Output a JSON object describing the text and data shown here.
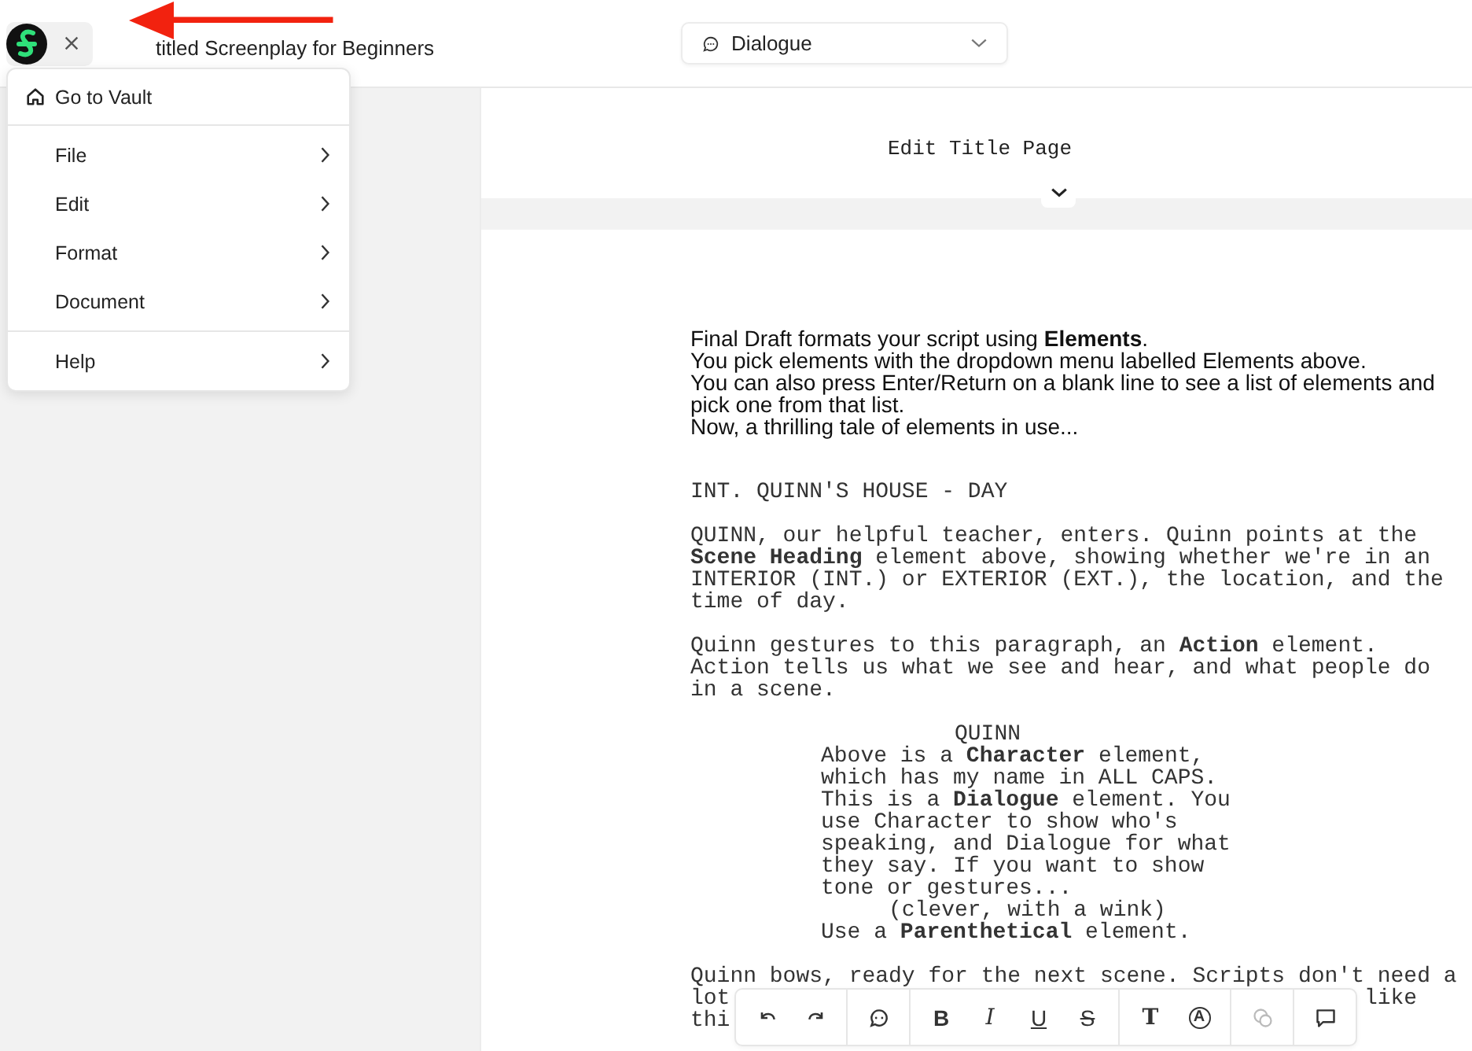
{
  "header": {
    "title": "titled Screenplay for Beginners",
    "element_dropdown": {
      "value": "Dialogue"
    }
  },
  "menu": {
    "sections": [
      [
        {
          "label": "Go to Vault",
          "kind": "home"
        }
      ],
      [
        {
          "label": "File",
          "kind": "submenu"
        },
        {
          "label": "Edit",
          "kind": "submenu"
        },
        {
          "label": "Format",
          "kind": "submenu"
        },
        {
          "label": "Document",
          "kind": "submenu"
        }
      ],
      [
        {
          "label": "Help",
          "kind": "submenu"
        }
      ]
    ]
  },
  "title_page": {
    "label": "Edit Title Page"
  },
  "script": {
    "intro": [
      "Final Draft formats your script using **Elements**.",
      "You pick elements with the dropdown menu labelled Elements above.",
      "You can also press Enter/Return on a blank line to see a list of elements and",
      "pick one from that list.",
      "Now, a thrilling tale of elements in use..."
    ],
    "elements": [
      {
        "kind": "scene_heading",
        "lines": [
          "INT. QUINN'S HOUSE - DAY"
        ]
      },
      {
        "kind": "action",
        "lines": [
          "QUINN, our helpful teacher, enters. Quinn points at the",
          "**Scene Heading** element above, showing whether we're in an",
          "INTERIOR (INT.) or EXTERIOR (EXT.), the location, and the",
          "time of day."
        ]
      },
      {
        "kind": "action",
        "lines": [
          "Quinn gestures to this paragraph, an **Action** element.",
          "Action tells us what we see and hear, and what people do",
          "in a scene."
        ]
      },
      {
        "kind": "character",
        "lines": [
          "QUINN"
        ]
      },
      {
        "kind": "dialogue",
        "lines": [
          "Above is a **Character** element,",
          "which has my name in ALL CAPS.",
          "This is a **Dialogue** element. You",
          "use Character to show who's",
          "speaking, and Dialogue for what",
          "they say. If you want to show",
          "tone or gestures..."
        ]
      },
      {
        "kind": "parenthetical",
        "lines": [
          "(clever, with a wink)"
        ]
      },
      {
        "kind": "dialogue",
        "lines": [
          "Use a **Parenthetical** element."
        ]
      },
      {
        "kind": "action_partial",
        "lines": [
          [
            "Quinn bows, ready for the next scene. Scripts don't need a"
          ],
          [
            "lot",
            "like"
          ],
          [
            "thi"
          ]
        ]
      }
    ]
  },
  "toolbar": {
    "groups": [
      [
        {
          "kind": "undo",
          "disabled": false
        },
        {
          "kind": "redo",
          "disabled": false
        }
      ],
      [
        {
          "kind": "dialogue",
          "disabled": false
        }
      ],
      [
        {
          "kind": "bold",
          "label": "B",
          "disabled": false
        },
        {
          "kind": "italic",
          "label": "I",
          "disabled": false
        },
        {
          "kind": "underline",
          "label": "U",
          "disabled": false
        },
        {
          "kind": "strike",
          "label": "S",
          "disabled": false
        }
      ],
      [
        {
          "kind": "text",
          "label": "T",
          "disabled": false
        },
        {
          "kind": "circled",
          "label": "A",
          "disabled": false
        }
      ],
      [
        {
          "kind": "comments",
          "disabled": true
        }
      ],
      [
        {
          "kind": "comment",
          "disabled": false
        }
      ]
    ]
  }
}
